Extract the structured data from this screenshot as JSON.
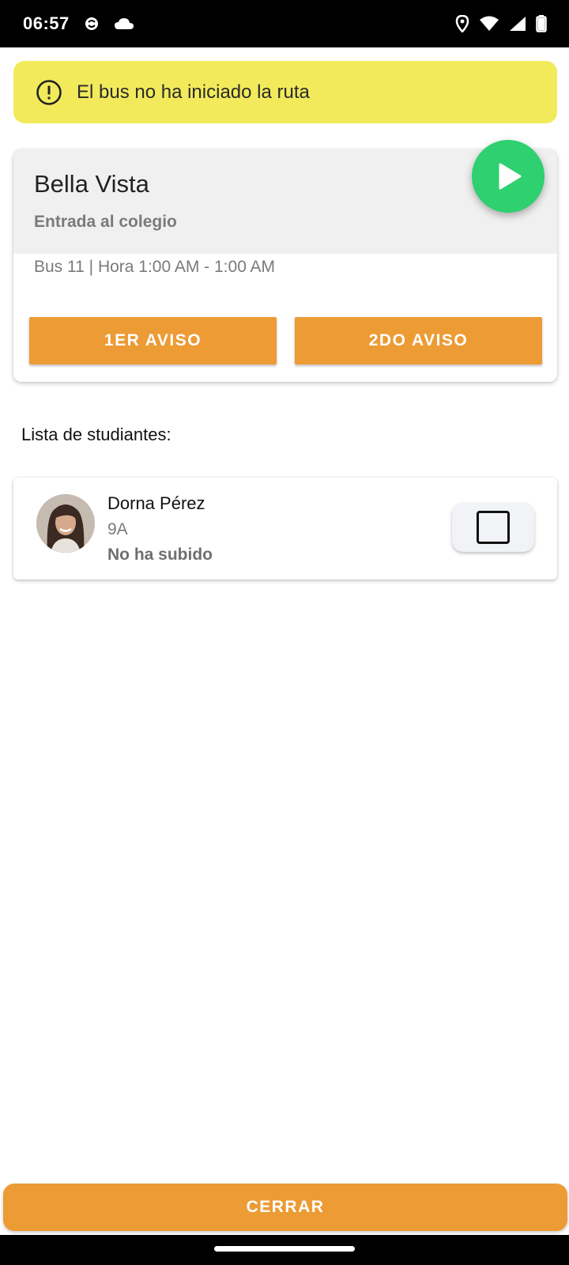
{
  "status_bar": {
    "time": "06:57",
    "left_icons": [
      "sync-icon",
      "cloud-icon"
    ],
    "right_icons": [
      "location-icon",
      "wifi-icon",
      "signal-icon",
      "battery-icon"
    ]
  },
  "alert": {
    "icon": "alert-circle-icon",
    "text": "El bus no ha iniciado la ruta",
    "background": "#f2ea5b"
  },
  "route": {
    "name": "Bella Vista",
    "type": "Entrada al colegio",
    "details": "Bus 11 | Hora 1:00 AM - 1:00 AM",
    "start_icon": "play-icon",
    "start_color": "#2ed070",
    "buttons": {
      "first_notice": "1ER AVISO",
      "second_notice": "2DO AVISO"
    },
    "accent": "#ec9b35"
  },
  "students": {
    "heading": "Lista de studiantes:",
    "items": [
      {
        "name": "Dorna Pérez",
        "grade": "9A",
        "status": "No ha subido",
        "checked": false
      }
    ]
  },
  "footer": {
    "close_label": "CERRAR"
  }
}
